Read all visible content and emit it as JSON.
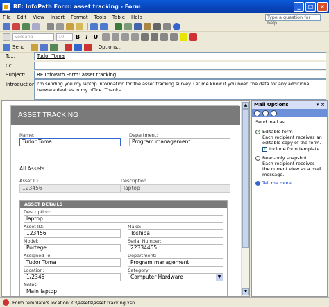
{
  "window": {
    "title": "RE: InfoPath Form: asset tracking - Form"
  },
  "menu": {
    "items": [
      "File",
      "Edit",
      "View",
      "Insert",
      "Format",
      "Tools",
      "Table",
      "Help"
    ],
    "help_placeholder": "Type a question for help"
  },
  "toolbar": {
    "font": "Verdana",
    "size": "10",
    "send_label": "Send",
    "options_label": "Options..."
  },
  "header": {
    "to_label": "To...",
    "to_value": "Tudor Toma",
    "cc_label": "Cc...",
    "cc_value": "",
    "subject_label": "Subject:",
    "subject_value": "RE:InfoPath Form: asset tracking",
    "intro_label": "Introduction:",
    "intro_value": "I'm sending you my laptop information for the asset tracking survey. Let me know if you need the data for any additional harware devices in my office. Thanks."
  },
  "form": {
    "banner": "ASSET TRACKING",
    "name_label": "Name:",
    "name_value": "Tudor Toma",
    "department_label": "Department:",
    "department_value": "Program management",
    "all_assets": "All Assets",
    "col_asset_id": "Asset ID",
    "col_description": "Description",
    "row_asset_id": "123456",
    "row_description": "laptop",
    "details_header": "ASSET DETAILS",
    "description_label": "Description:",
    "description_value": "laptop",
    "assetid_label": "Asset ID:",
    "assetid_value": "123456",
    "make_label": "Make:",
    "make_value": "Toshiba",
    "model_label": "Model:",
    "model_value": "Portege",
    "serial_label": "Serial Number:",
    "serial_value": "22334455",
    "assigned_label": "Assigned To:",
    "assigned_value": "Tudor Toma",
    "dept2_label": "Department:",
    "dept2_value": "Program management",
    "location_label": "Location:",
    "location_value": "1/2345",
    "category_label": "Category:",
    "category_value": "Computer Hardware",
    "notes_label": "Notes:",
    "notes_value": "Main laptop"
  },
  "pane": {
    "title": "Mail Options",
    "send_mail_as": "Send mail as",
    "editable_form": "Editable form",
    "editable_desc": "Each recipient receives an editable copy of the form.",
    "include_template": "Include form template",
    "readonly": "Read-only snapshot",
    "readonly_desc": "Each recipient receives the current view as a mail message.",
    "tell_more": "Tell me more..."
  },
  "status": {
    "text": "Form template's location: C:\\assets\\asset tracking.xsn"
  }
}
